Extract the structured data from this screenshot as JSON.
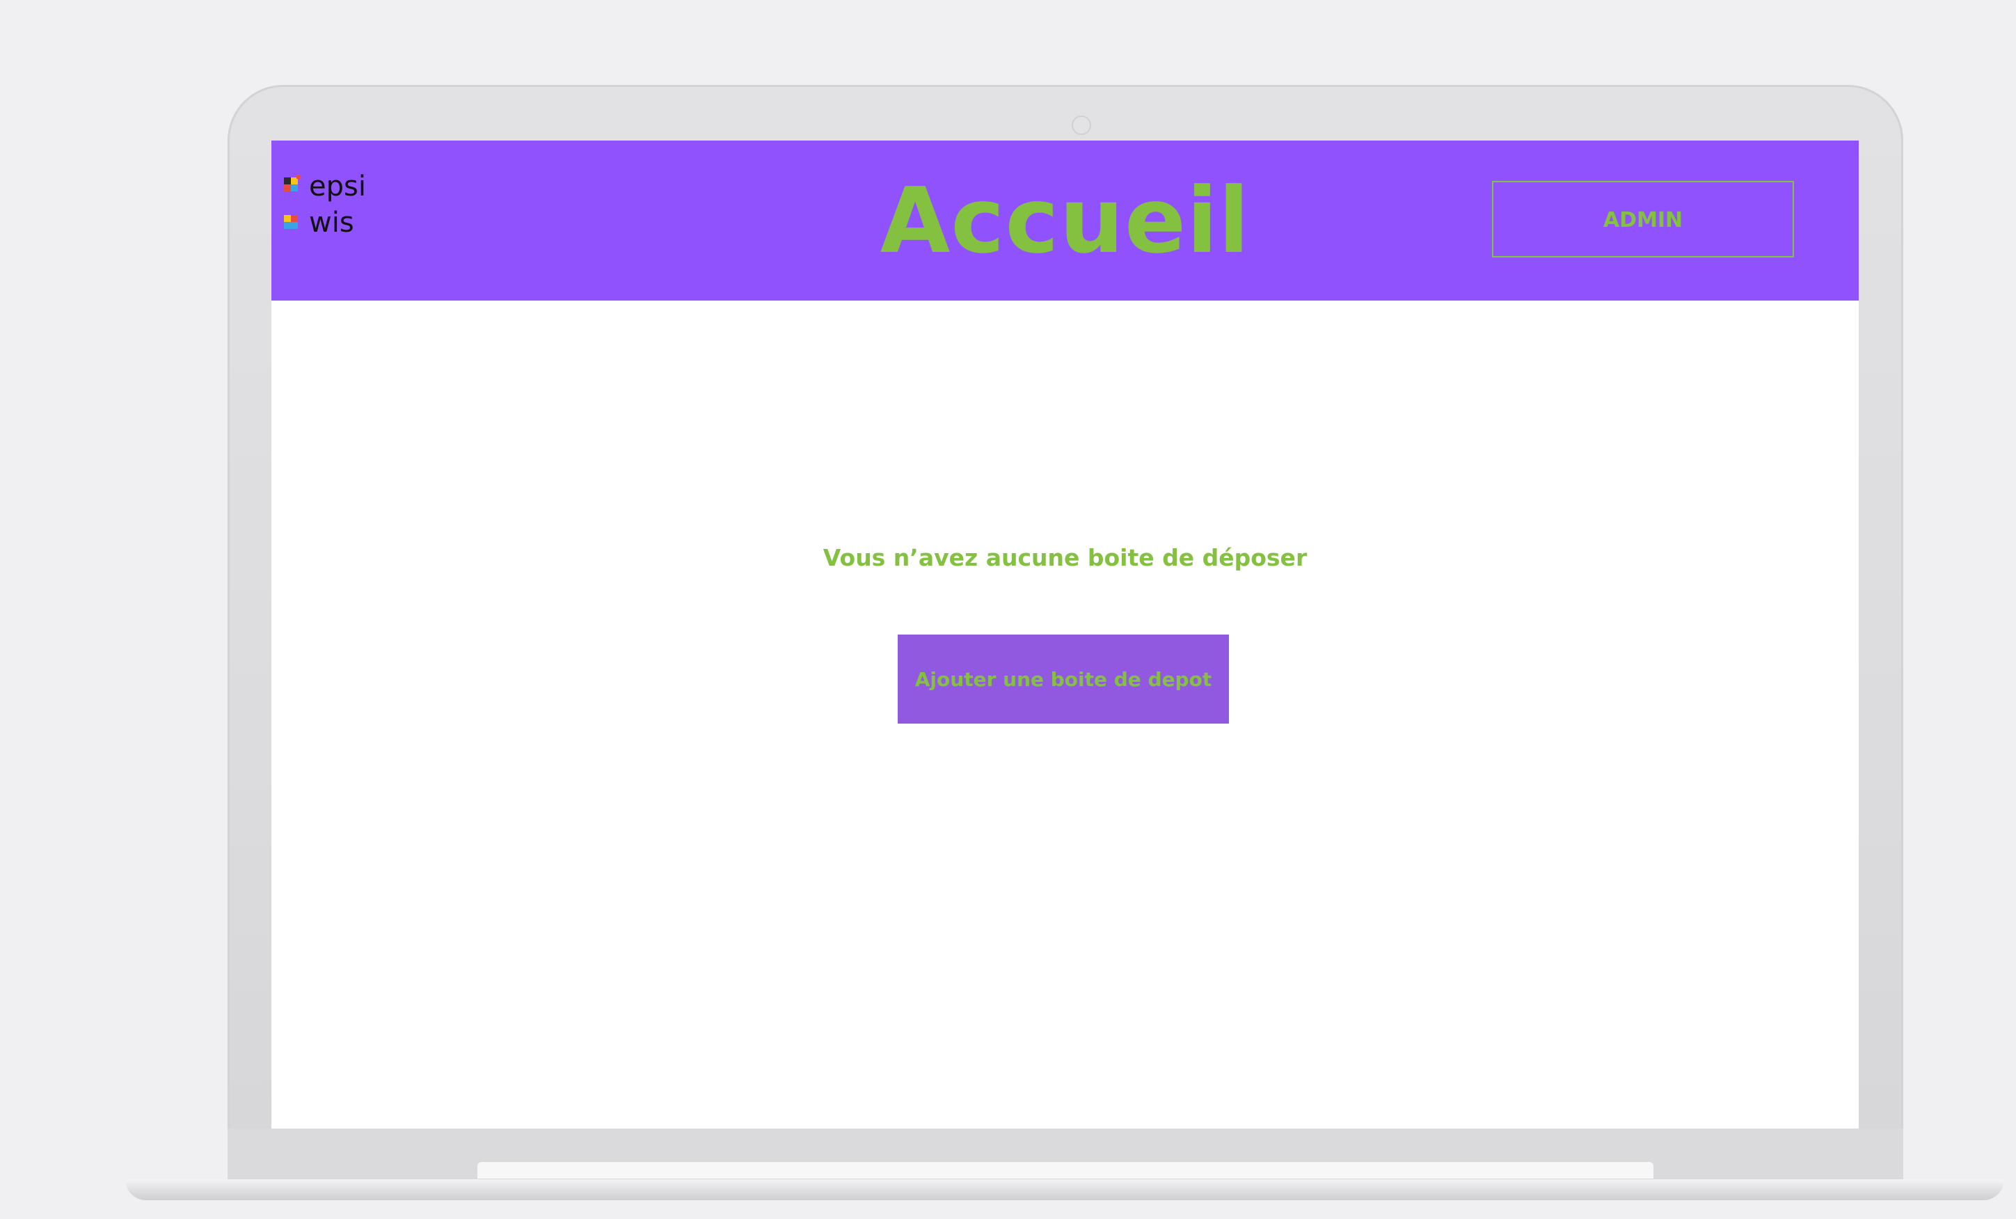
{
  "header": {
    "logo_line1": "epsi",
    "logo_line2": "wis",
    "title": "Accueil",
    "admin_label": "ADMIN"
  },
  "main": {
    "empty_message": "Vous n’avez aucune boite de déposer",
    "add_button_label": "Ajouter une boite de depot"
  },
  "colors": {
    "header_bg": "#9052fd",
    "accent_green": "#85c141",
    "button_bg": "#9059e0",
    "page_bg": "#f0f0f3"
  }
}
